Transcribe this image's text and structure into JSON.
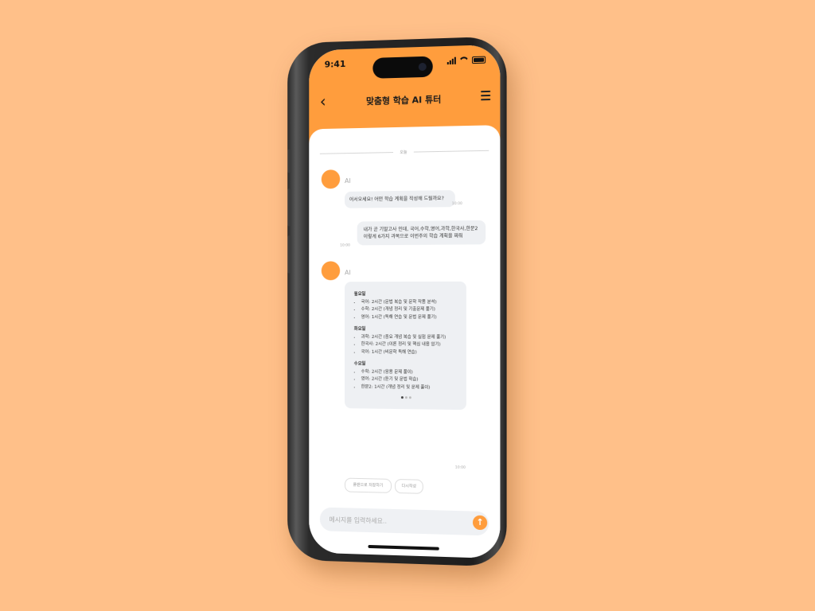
{
  "status": {
    "time": "9:41"
  },
  "header": {
    "title": "맞춤형 학습 AI 튜터",
    "back_icon": "chevron-left-icon",
    "menu_icon": "hamburger-menu-icon"
  },
  "chat": {
    "date_divider": "오늘",
    "messages": [
      {
        "sender": "AI",
        "text": "어서오세요! 어떤 학습 계획을 작성해 드릴까요?",
        "time": "10:00"
      },
      {
        "sender": "user",
        "text": "내가 곧 기말고사 인데, 국어,수학,영어,과학,한국사,한문2 이렇게 6가지 과목으로 이번주의 학습 계획을 짜줘",
        "time": "10:00"
      },
      {
        "sender": "AI",
        "time": "10:00",
        "plan": [
          {
            "day": "월요일",
            "items": [
              "국어: 2시간 (문법 복습 및 문학 작품 분석)",
              "수학: 2시간 (개념 정리 및 기출문제 풀기)",
              "영어: 1시간 (독해 연습 및 문법 문제 풀기)"
            ]
          },
          {
            "day": "화요일",
            "items": [
              "과학: 2시간 (중요 개념 복습 및 실험 문제 풀기)",
              "한국사: 2시간 (이론 정리 및 핵심 내용 암기)",
              "국어: 1시간 (비문학 독해 연습)"
            ]
          },
          {
            "day": "수요일",
            "items": [
              "수학: 2시간 (응용 문제 풀이)",
              "영어: 2시간 (듣기 및 문법 학습)",
              "한문2: 1시간 (개념 정리 및 문제 풀이)"
            ]
          }
        ],
        "pager": {
          "current": 1,
          "total": 3
        }
      }
    ],
    "quick_replies": [
      "플랜으로 저장하기",
      "다시작성"
    ]
  },
  "composer": {
    "placeholder": "메시지를 입력하세요..",
    "send_icon": "arrow-up-icon"
  }
}
